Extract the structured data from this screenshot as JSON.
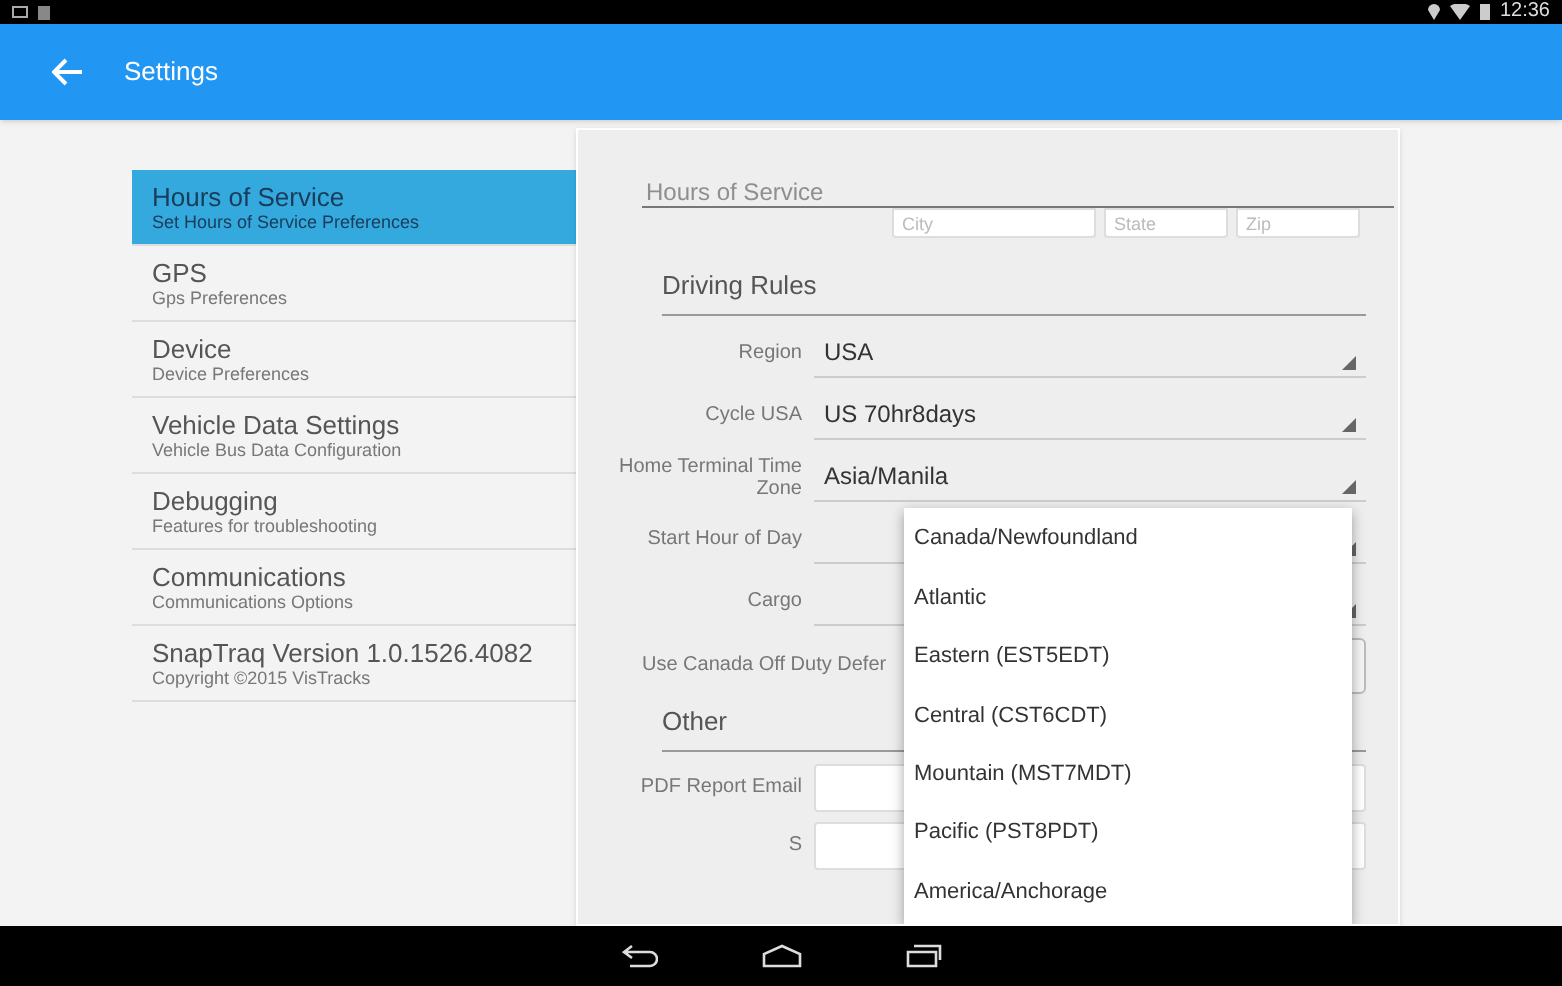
{
  "status_bar": {
    "time": "12:36"
  },
  "app_bar": {
    "title": "Settings"
  },
  "sidebar": {
    "items": [
      {
        "title": "Hours of Service",
        "subtitle": "Set Hours of Service Preferences",
        "selected": true
      },
      {
        "title": "GPS",
        "subtitle": "Gps Preferences",
        "selected": false
      },
      {
        "title": "Device",
        "subtitle": "Device Preferences",
        "selected": false
      },
      {
        "title": "Vehicle Data Settings",
        "subtitle": "Vehicle Bus Data Configuration",
        "selected": false
      },
      {
        "title": "Debugging",
        "subtitle": "Features for troubleshooting",
        "selected": false
      },
      {
        "title": "Communications",
        "subtitle": "Communications Options",
        "selected": false
      },
      {
        "title": "SnapTraq Version 1.0.1526.4082",
        "subtitle": "Copyright ©2015 VisTracks",
        "selected": false
      }
    ]
  },
  "panel": {
    "title": "Hours of Service",
    "address_fields": [
      {
        "placeholder": "City"
      },
      {
        "placeholder": "State"
      },
      {
        "placeholder": "Zip"
      }
    ],
    "sections": [
      {
        "title": "Driving Rules",
        "rows": [
          {
            "kind": "select",
            "label": "Region",
            "value": "USA"
          },
          {
            "kind": "select",
            "label": "Cycle USA",
            "value": "US 70hr8days"
          },
          {
            "kind": "select",
            "label": "Home Terminal Time Zone",
            "value": "Asia/Manila"
          },
          {
            "kind": "select",
            "label": "Start Hour of Day"
          },
          {
            "kind": "select",
            "label": "Cargo"
          },
          {
            "kind": "button",
            "label": "Use Canada Off Duty Defer"
          }
        ]
      },
      {
        "title": "Other",
        "rows": [
          {
            "kind": "input",
            "label": "PDF Report Email"
          },
          {
            "kind": "input",
            "label": "S"
          }
        ]
      }
    ]
  },
  "dropdown": {
    "options": [
      "Canada/Newfoundland",
      "Atlantic",
      "Eastern (EST5EDT)",
      "Central (CST6CDT)",
      "Mountain (MST7MDT)",
      "Pacific (PST8PDT)",
      "America/Anchorage"
    ]
  }
}
